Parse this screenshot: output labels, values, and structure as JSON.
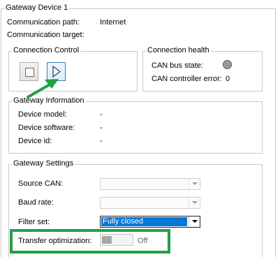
{
  "gateway_group": {
    "title": "Gateway Device 1",
    "communication_path_label": "Communication path:",
    "communication_path_value": "Internet",
    "communication_target_label": "Communication target:"
  },
  "connection_control": {
    "title": "Connection Control",
    "stop_icon": "stop-square-icon",
    "play_icon": "play-triangle-icon"
  },
  "connection_health": {
    "title": "Connection health",
    "can_bus_state_label": "CAN bus state:",
    "can_controller_error_label": "CAN controller error:",
    "can_controller_error_value": "0",
    "status_indicator_color": "#9a9a9a"
  },
  "gateway_information": {
    "title": "Gateway Information",
    "device_model_label": "Device model:",
    "device_model_value": "-",
    "device_software_label": "Device software:",
    "device_software_value": "-",
    "device_id_label": "Device id:",
    "device_id_value": "-"
  },
  "gateway_settings": {
    "title": "Gateway Settings",
    "source_can_label": "Source CAN:",
    "source_can_value": "",
    "baud_rate_label": "Baud rate:",
    "baud_rate_value": "",
    "filter_set_label": "Filter set:",
    "filter_set_value": "Fully closed",
    "transfer_optimization_label": "Transfer optimization:",
    "transfer_optimization_state": "Off"
  },
  "annotations": {
    "highlight_color": "#22a043",
    "arrow_color": "#22a043"
  }
}
